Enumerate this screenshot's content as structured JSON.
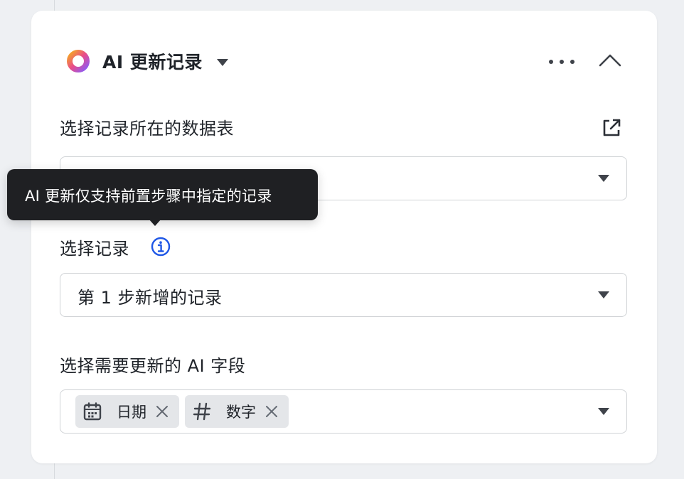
{
  "header": {
    "title": "AI 更新记录",
    "logo_icon": "ai-gradient-ring-icon",
    "more_icon": "more-horizontal-icon",
    "collapse_icon": "chevron-up-icon"
  },
  "table_section": {
    "label": "选择记录所在的数据表",
    "link_icon": "external-link-icon",
    "selected_value": ""
  },
  "record_section": {
    "label": "选择记录",
    "info_icon": "info-icon",
    "selected_value": "第 1 步新增的记录"
  },
  "fields_section": {
    "label": "选择需要更新的 AI 字段",
    "tags": [
      {
        "label": "日期",
        "icon": "calendar-icon"
      },
      {
        "label": "数字",
        "icon": "hash-icon"
      }
    ]
  },
  "tooltip": {
    "text": "AI 更新仅支持前置步骤中指定的记录"
  },
  "colors": {
    "accent_info": "#1f57e6",
    "tooltip_bg": "#1f2023",
    "border": "#d0d3d6",
    "tag_bg": "#e4e6e9",
    "logo_gradient": [
      "#f5a623",
      "#e94b8a",
      "#8b5cf6"
    ]
  }
}
